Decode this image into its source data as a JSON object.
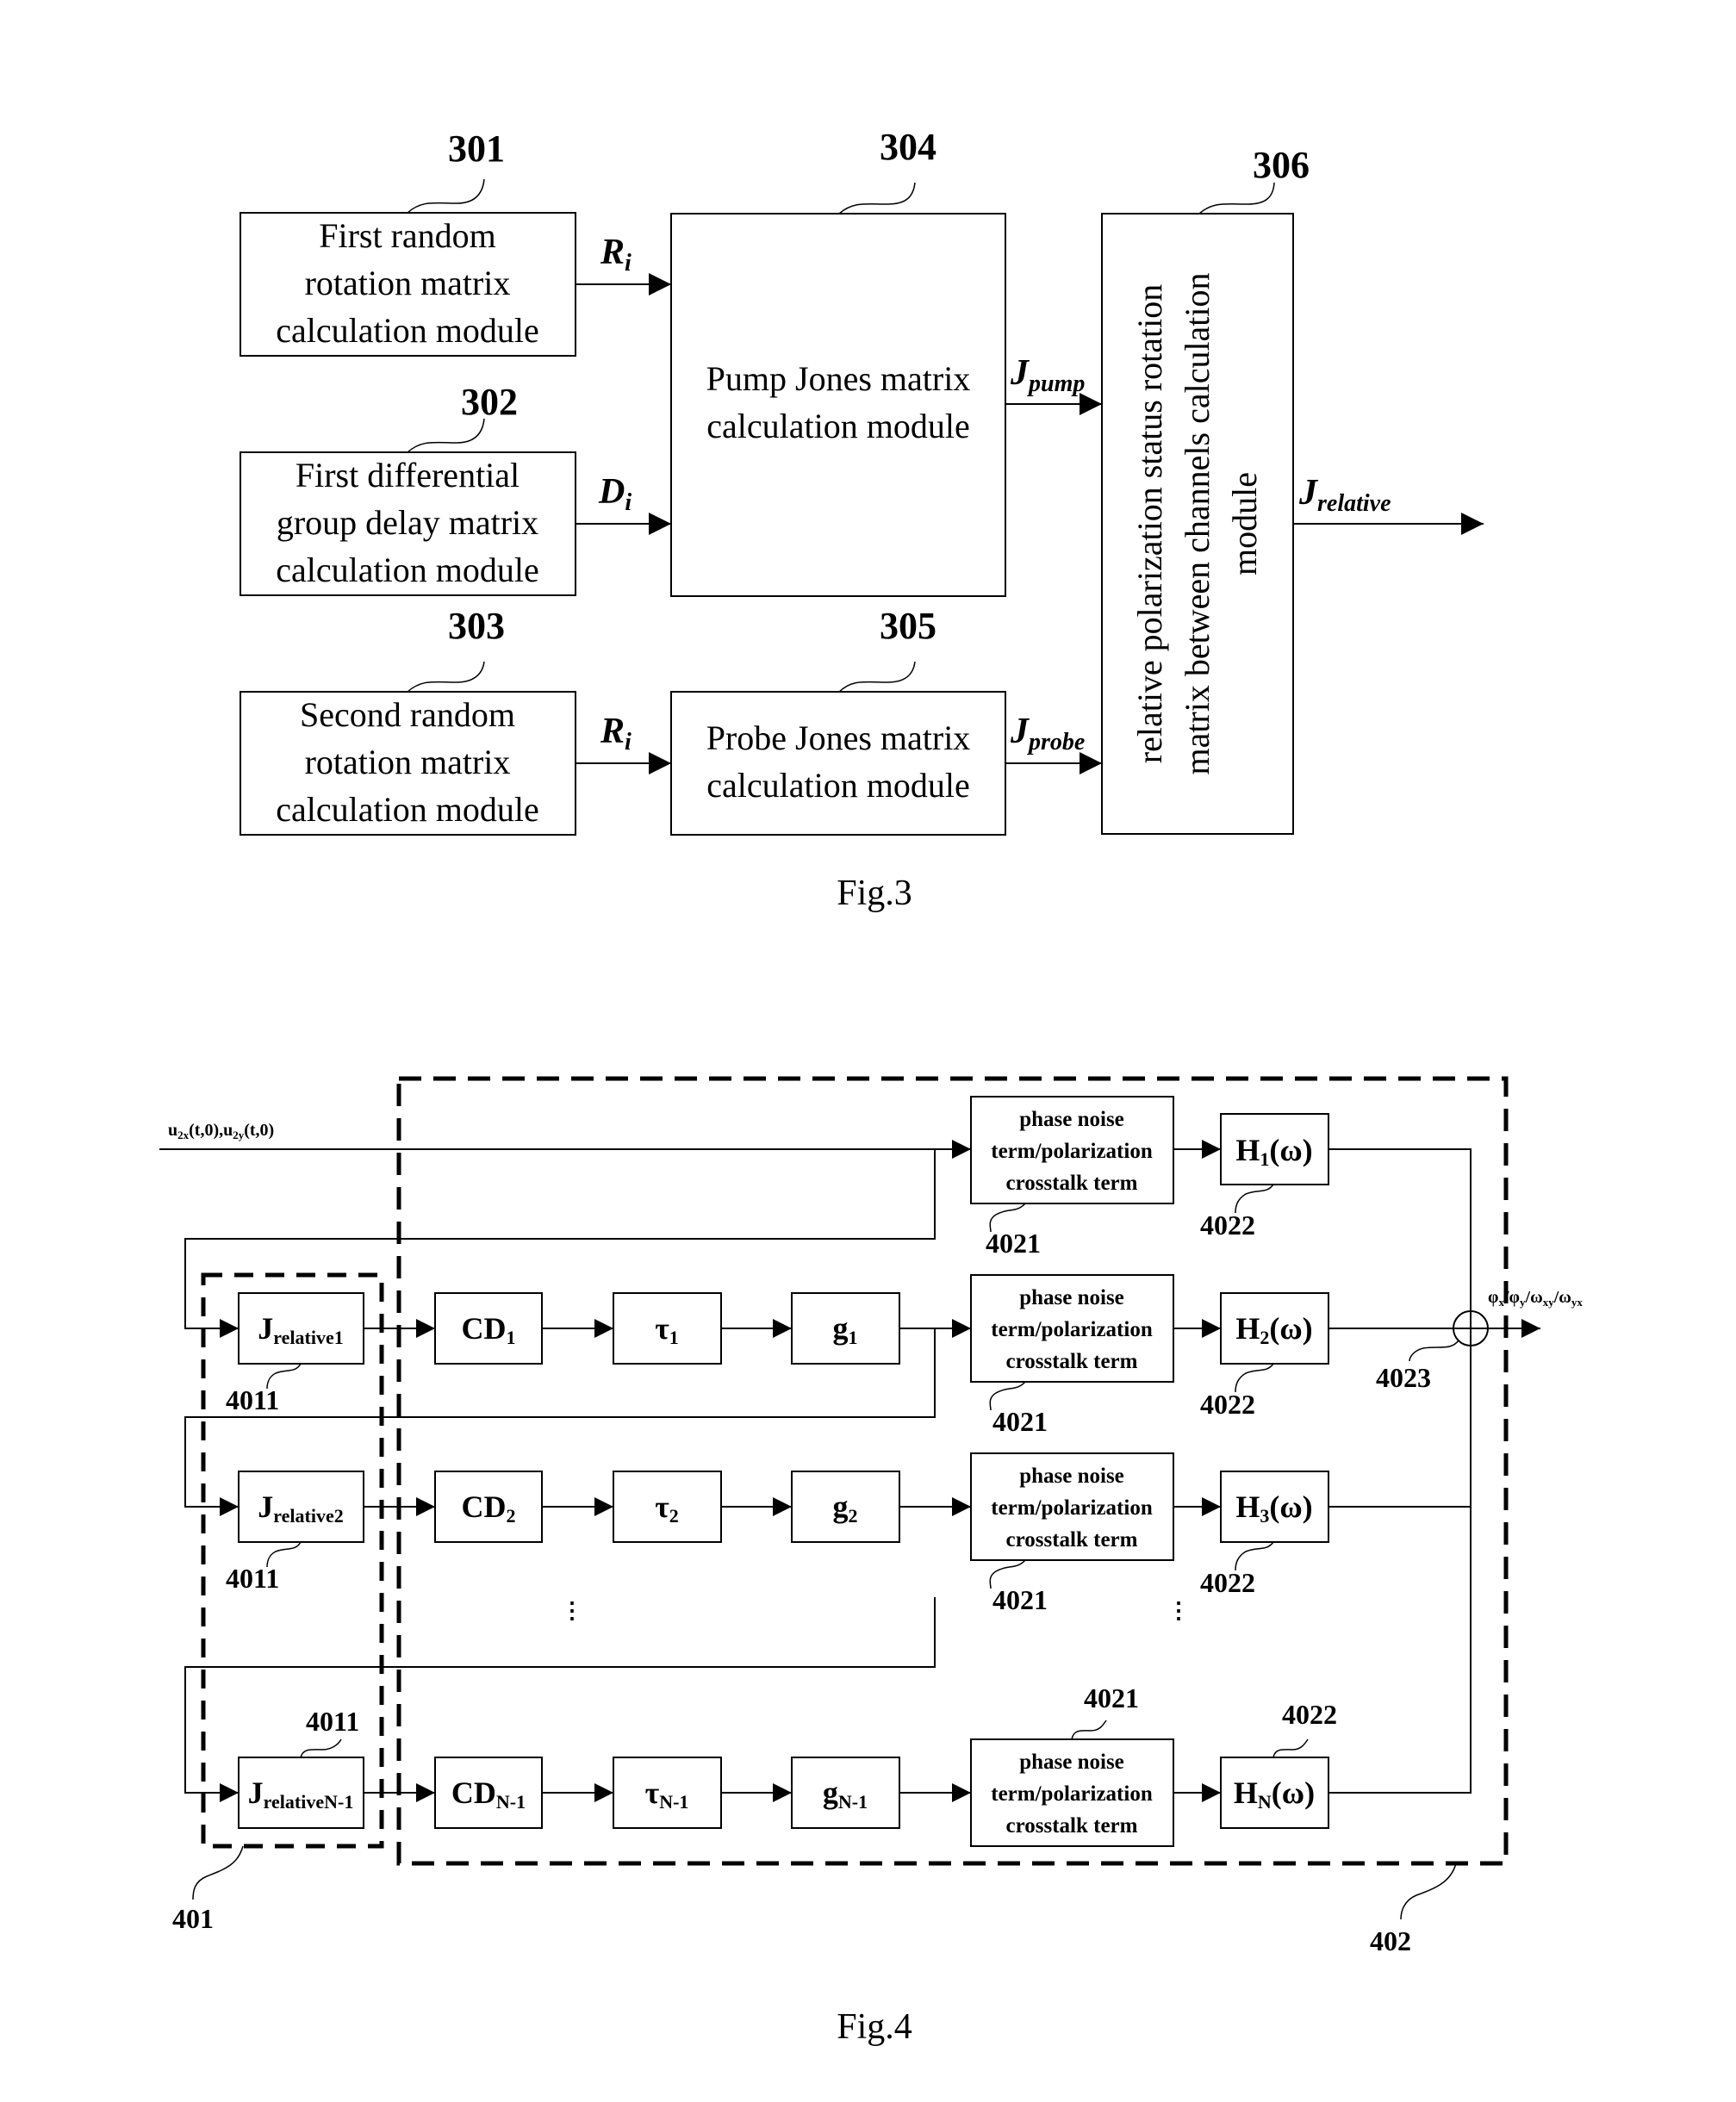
{
  "fig3": {
    "caption": "Fig.3",
    "modules": {
      "m301": {
        "ref": "301",
        "lines": [
          "First random",
          "rotation matrix",
          "calculation module"
        ]
      },
      "m302": {
        "ref": "302",
        "lines": [
          "First differential",
          "group delay matrix",
          "calculation module"
        ]
      },
      "m303": {
        "ref": "303",
        "lines": [
          "Second random",
          "rotation matrix",
          "calculation module"
        ]
      },
      "m304": {
        "ref": "304",
        "lines": [
          "Pump Jones matrix",
          "calculation module"
        ]
      },
      "m305": {
        "ref": "305",
        "lines": [
          "Probe Jones matrix",
          "calculation module"
        ]
      },
      "m306": {
        "ref": "306",
        "lines": [
          "relative polarization status rotation",
          "matrix between channels calculation",
          "module"
        ]
      }
    },
    "signals": {
      "ri_top": {
        "main": "R",
        "sub": "i"
      },
      "di": {
        "main": "D",
        "sub": "i"
      },
      "ri_bottom": {
        "main": "R",
        "sub": "i"
      },
      "jpump": {
        "main": "J",
        "sub": "pump"
      },
      "jprobe": {
        "main": "J",
        "sub": "probe"
      },
      "jrelative": {
        "main": "J",
        "sub": "relative"
      }
    }
  },
  "fig4": {
    "caption": "Fig.4",
    "input_label": {
      "a": "u",
      "a_sub": "2x",
      "b": "(t,0),u",
      "b_sub": "2y",
      "c": "(t,0)"
    },
    "output_label": {
      "p1": "φ",
      "p1_sub": "x",
      "sep1": "/φ",
      "p2_sub": "y",
      "sep2": "/ω",
      "p3_sub": "xy",
      "sep3": "/ω",
      "p4_sub": "yx"
    },
    "group_refs": {
      "g401": "401",
      "g402": "402",
      "sum": "4023"
    },
    "phase_box_lines": [
      "phase noise",
      "term/polarization",
      "crosstalk term"
    ],
    "rows": [
      {
        "j": null,
        "h_main": "H",
        "h_sub": "1",
        "h_tail": "(ω)",
        "ref_phase": "4021",
        "ref_h": "4022"
      },
      {
        "j_main": "J",
        "j_sub": "relative1",
        "cd_main": "CD",
        "cd_sub": "1",
        "tau_main": "τ",
        "tau_sub": "1",
        "g_main": "g",
        "g_sub": "1",
        "h_main": "H",
        "h_sub": "2",
        "h_tail": "(ω)",
        "ref_j": "4011",
        "ref_phase": "4021",
        "ref_h": "4022"
      },
      {
        "j_main": "J",
        "j_sub": "relative2",
        "cd_main": "CD",
        "cd_sub": "2",
        "tau_main": "τ",
        "tau_sub": "2",
        "g_main": "g",
        "g_sub": "2",
        "h_main": "H",
        "h_sub": "3",
        "h_tail": "(ω)",
        "ref_j": "4011",
        "ref_phase": "4021",
        "ref_h": "4022"
      },
      {
        "j_main": "J",
        "j_sub": "relativeN-1",
        "cd_main": "CD",
        "cd_sub": "N-1",
        "tau_main": "τ",
        "tau_sub": "N-1",
        "g_main": "g",
        "g_sub": "N-1",
        "h_main": "H",
        "h_sub": "N",
        "h_tail": "(ω)",
        "ref_j": "4011",
        "ref_phase": "4021",
        "ref_h": "4022"
      }
    ],
    "ellipsis": "⋮"
  }
}
